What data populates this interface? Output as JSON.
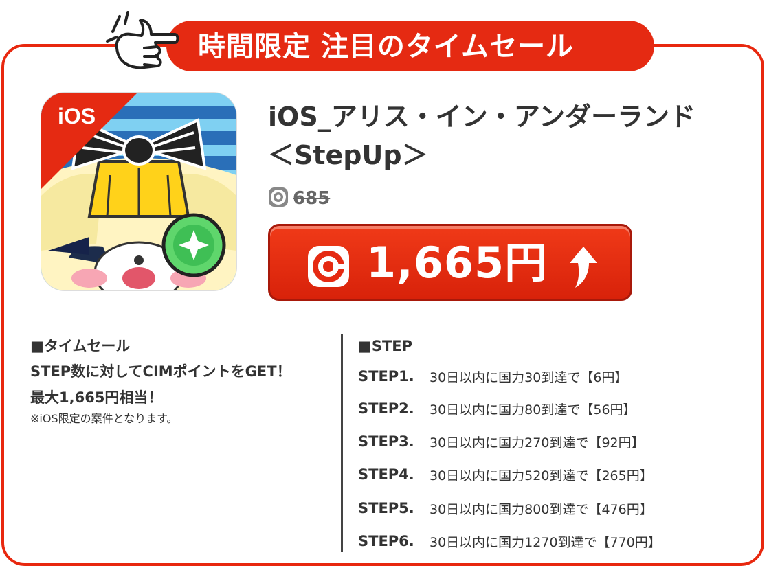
{
  "banner": {
    "title": "時間限定 注目のタイムセール"
  },
  "product": {
    "platform_badge": "iOS",
    "title_line1": "iOS_アリス・イン・アンダーランド",
    "title_line2": "＜StepUp＞",
    "old_points": "685",
    "price": "1,665円"
  },
  "sale": {
    "heading": "■タイムセール",
    "line1": "STEP数に対してCIMポイントをGET！",
    "line2": "最大1,665円相当！",
    "note": "※iOS限定の案件となります。"
  },
  "steps": {
    "heading": "■STEP",
    "items": [
      {
        "label": "STEP1.",
        "text": "30日以内に国力30到達で【6円】"
      },
      {
        "label": "STEP2.",
        "text": "30日以内に国力80到達で【56円】"
      },
      {
        "label": "STEP3.",
        "text": "30日以内に国力270到達で【92円】"
      },
      {
        "label": "STEP4.",
        "text": "30日以内に国力520到達で【265円】"
      },
      {
        "label": "STEP5.",
        "text": "30日以内に国力800到達で【476円】"
      },
      {
        "label": "STEP6.",
        "text": "30日以内に国力1270到達で【770円】"
      }
    ]
  },
  "colors": {
    "accent": "#e52a12",
    "border": "#e8280f",
    "text": "#333333"
  },
  "icons": [
    "pointing-hand-icon",
    "coin-icon",
    "up-arrow-icon"
  ]
}
